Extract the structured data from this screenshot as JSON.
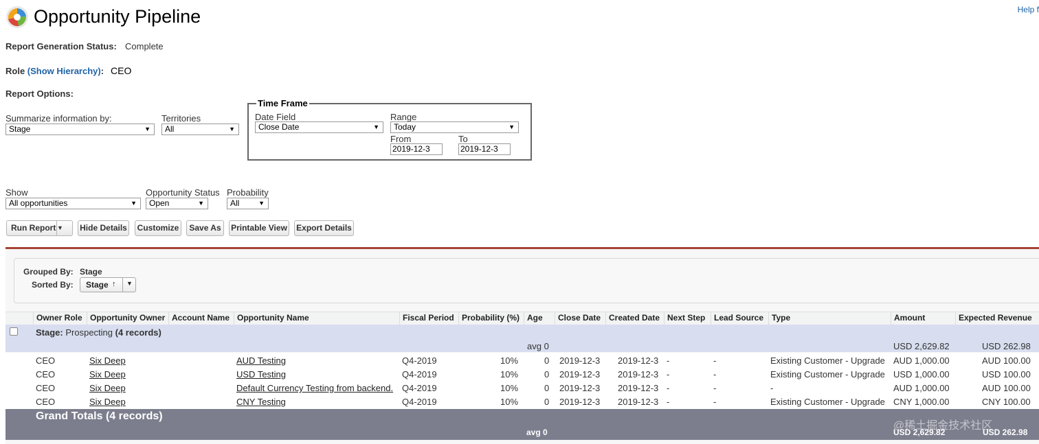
{
  "header": {
    "title": "Opportunity Pipeline",
    "help_link": "Help f"
  },
  "status": {
    "label": "Report Generation Status:",
    "value": "Complete"
  },
  "role": {
    "label": "Role",
    "link": "(Show Hierarchy)",
    "colon": ":",
    "value": "CEO"
  },
  "report_options_label": "Report Options:",
  "filters": {
    "summarize_label": "Summarize information by:",
    "summarize_value": "Stage",
    "territories_label": "Territories",
    "territories_value": "All",
    "show_label": "Show",
    "show_value": "All opportunities",
    "opp_status_label": "Opportunity Status",
    "opp_status_value": "Open",
    "probability_label": "Probability",
    "probability_value": "All"
  },
  "time_frame": {
    "legend": "Time Frame",
    "date_field_label": "Date Field",
    "date_field_value": "Close Date",
    "range_label": "Range",
    "range_value": "Today",
    "from_label": "From",
    "from_value": "2019-12-3",
    "to_label": "To",
    "to_value": "2019-12-3"
  },
  "buttons": {
    "run_report": "Run Report",
    "hide_details": "Hide Details",
    "customize": "Customize",
    "save_as": "Save As",
    "printable_view": "Printable View",
    "export_details": "Export Details"
  },
  "grouping": {
    "grouped_by_label": "Grouped By:",
    "grouped_by_value": "Stage",
    "sorted_by_label": "Sorted By:",
    "sorted_by_value": "Stage",
    "sort_direction": "↑"
  },
  "table": {
    "columns": [
      "Owner Role",
      "Opportunity Owner",
      "Account Name",
      "Opportunity Name",
      "Fiscal Period",
      "Probability (%)",
      "Age",
      "Close Date",
      "Created Date",
      "Next Step",
      "Lead Source",
      "Type",
      "Amount",
      "Expected Revenue"
    ],
    "group": {
      "stage_label": "Stage:",
      "stage_value": "Prospecting",
      "count": "(4 records)",
      "avg_age": "avg 0",
      "amount": "USD 2,629.82",
      "expected_revenue": "USD 262.98"
    },
    "rows": [
      {
        "owner_role": "CEO",
        "owner": "Six Deep",
        "account": "",
        "name": "AUD Testing",
        "fiscal": "Q4-2019",
        "prob": "10%",
        "age": "0",
        "close": "2019-12-3",
        "created": "2019-12-3",
        "next": "-",
        "lead": "-",
        "type": "Existing Customer - Upgrade",
        "amount": "AUD 1,000.00",
        "expected": "AUD 100.00"
      },
      {
        "owner_role": "CEO",
        "owner": "Six Deep",
        "account": "",
        "name": "USD Testing",
        "fiscal": "Q4-2019",
        "prob": "10%",
        "age": "0",
        "close": "2019-12-3",
        "created": "2019-12-3",
        "next": "-",
        "lead": "-",
        "type": "Existing Customer - Upgrade",
        "amount": "USD 1,000.00",
        "expected": "USD 100.00"
      },
      {
        "owner_role": "CEO",
        "owner": "Six Deep",
        "account": "",
        "name": "Default Currency Testing from backend.",
        "fiscal": "Q4-2019",
        "prob": "10%",
        "age": "0",
        "close": "2019-12-3",
        "created": "2019-12-3",
        "next": "-",
        "lead": "-",
        "type": "-",
        "amount": "AUD 1,000.00",
        "expected": "AUD 100.00"
      },
      {
        "owner_role": "CEO",
        "owner": "Six Deep",
        "account": "",
        "name": "CNY Testing",
        "fiscal": "Q4-2019",
        "prob": "10%",
        "age": "0",
        "close": "2019-12-3",
        "created": "2019-12-3",
        "next": "-",
        "lead": "-",
        "type": "Existing Customer - Upgrade",
        "amount": "CNY 1,000.00",
        "expected": "CNY 100.00"
      }
    ],
    "totals": {
      "label": "Grand Totals (4 records)",
      "avg_age": "avg 0",
      "amount": "USD 2,629.82",
      "expected_revenue": "USD 262.98"
    }
  },
  "watermark": "@稀土掘金技术社区",
  "colors": {
    "accent_red": "#a74336",
    "group_row": "#d8deef",
    "totals_row": "#7c7e8d",
    "link_blue": "#1f63a6"
  }
}
